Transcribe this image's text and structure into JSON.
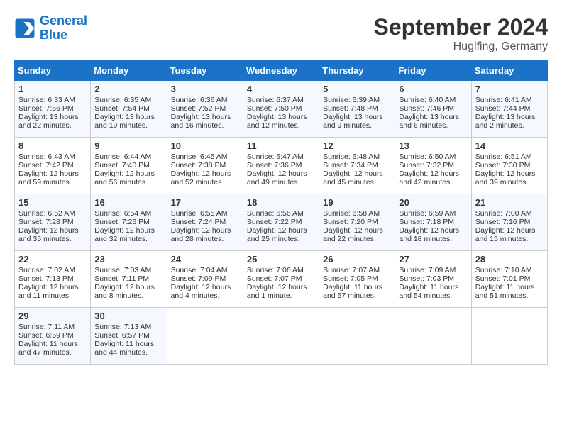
{
  "logo": {
    "line1": "General",
    "line2": "Blue"
  },
  "title": "September 2024",
  "subtitle": "Huglfing, Germany",
  "days_of_week": [
    "Sunday",
    "Monday",
    "Tuesday",
    "Wednesday",
    "Thursday",
    "Friday",
    "Saturday"
  ],
  "weeks": [
    [
      {
        "day": "1",
        "sunrise": "6:33 AM",
        "sunset": "7:56 PM",
        "daylight": "13 hours and 22 minutes."
      },
      {
        "day": "2",
        "sunrise": "6:35 AM",
        "sunset": "7:54 PM",
        "daylight": "13 hours and 19 minutes."
      },
      {
        "day": "3",
        "sunrise": "6:36 AM",
        "sunset": "7:52 PM",
        "daylight": "13 hours and 16 minutes."
      },
      {
        "day": "4",
        "sunrise": "6:37 AM",
        "sunset": "7:50 PM",
        "daylight": "13 hours and 12 minutes."
      },
      {
        "day": "5",
        "sunrise": "6:39 AM",
        "sunset": "7:48 PM",
        "daylight": "13 hours and 9 minutes."
      },
      {
        "day": "6",
        "sunrise": "6:40 AM",
        "sunset": "7:46 PM",
        "daylight": "13 hours and 6 minutes."
      },
      {
        "day": "7",
        "sunrise": "6:41 AM",
        "sunset": "7:44 PM",
        "daylight": "13 hours and 2 minutes."
      }
    ],
    [
      {
        "day": "8",
        "sunrise": "6:43 AM",
        "sunset": "7:42 PM",
        "daylight": "12 hours and 59 minutes."
      },
      {
        "day": "9",
        "sunrise": "6:44 AM",
        "sunset": "7:40 PM",
        "daylight": "12 hours and 56 minutes."
      },
      {
        "day": "10",
        "sunrise": "6:45 AM",
        "sunset": "7:38 PM",
        "daylight": "12 hours and 52 minutes."
      },
      {
        "day": "11",
        "sunrise": "6:47 AM",
        "sunset": "7:36 PM",
        "daylight": "12 hours and 49 minutes."
      },
      {
        "day": "12",
        "sunrise": "6:48 AM",
        "sunset": "7:34 PM",
        "daylight": "12 hours and 45 minutes."
      },
      {
        "day": "13",
        "sunrise": "6:50 AM",
        "sunset": "7:32 PM",
        "daylight": "12 hours and 42 minutes."
      },
      {
        "day": "14",
        "sunrise": "6:51 AM",
        "sunset": "7:30 PM",
        "daylight": "12 hours and 39 minutes."
      }
    ],
    [
      {
        "day": "15",
        "sunrise": "6:52 AM",
        "sunset": "7:28 PM",
        "daylight": "12 hours and 35 minutes."
      },
      {
        "day": "16",
        "sunrise": "6:54 AM",
        "sunset": "7:26 PM",
        "daylight": "12 hours and 32 minutes."
      },
      {
        "day": "17",
        "sunrise": "6:55 AM",
        "sunset": "7:24 PM",
        "daylight": "12 hours and 28 minutes."
      },
      {
        "day": "18",
        "sunrise": "6:56 AM",
        "sunset": "7:22 PM",
        "daylight": "12 hours and 25 minutes."
      },
      {
        "day": "19",
        "sunrise": "6:58 AM",
        "sunset": "7:20 PM",
        "daylight": "12 hours and 22 minutes."
      },
      {
        "day": "20",
        "sunrise": "6:59 AM",
        "sunset": "7:18 PM",
        "daylight": "12 hours and 18 minutes."
      },
      {
        "day": "21",
        "sunrise": "7:00 AM",
        "sunset": "7:16 PM",
        "daylight": "12 hours and 15 minutes."
      }
    ],
    [
      {
        "day": "22",
        "sunrise": "7:02 AM",
        "sunset": "7:13 PM",
        "daylight": "12 hours and 11 minutes."
      },
      {
        "day": "23",
        "sunrise": "7:03 AM",
        "sunset": "7:11 PM",
        "daylight": "12 hours and 8 minutes."
      },
      {
        "day": "24",
        "sunrise": "7:04 AM",
        "sunset": "7:09 PM",
        "daylight": "12 hours and 4 minutes."
      },
      {
        "day": "25",
        "sunrise": "7:06 AM",
        "sunset": "7:07 PM",
        "daylight": "12 hours and 1 minute."
      },
      {
        "day": "26",
        "sunrise": "7:07 AM",
        "sunset": "7:05 PM",
        "daylight": "11 hours and 57 minutes."
      },
      {
        "day": "27",
        "sunrise": "7:09 AM",
        "sunset": "7:03 PM",
        "daylight": "11 hours and 54 minutes."
      },
      {
        "day": "28",
        "sunrise": "7:10 AM",
        "sunset": "7:01 PM",
        "daylight": "11 hours and 51 minutes."
      }
    ],
    [
      {
        "day": "29",
        "sunrise": "7:11 AM",
        "sunset": "6:59 PM",
        "daylight": "11 hours and 47 minutes."
      },
      {
        "day": "30",
        "sunrise": "7:13 AM",
        "sunset": "6:57 PM",
        "daylight": "11 hours and 44 minutes."
      },
      {
        "day": "",
        "sunrise": "",
        "sunset": "",
        "daylight": ""
      },
      {
        "day": "",
        "sunrise": "",
        "sunset": "",
        "daylight": ""
      },
      {
        "day": "",
        "sunrise": "",
        "sunset": "",
        "daylight": ""
      },
      {
        "day": "",
        "sunrise": "",
        "sunset": "",
        "daylight": ""
      },
      {
        "day": "",
        "sunrise": "",
        "sunset": "",
        "daylight": ""
      }
    ]
  ]
}
